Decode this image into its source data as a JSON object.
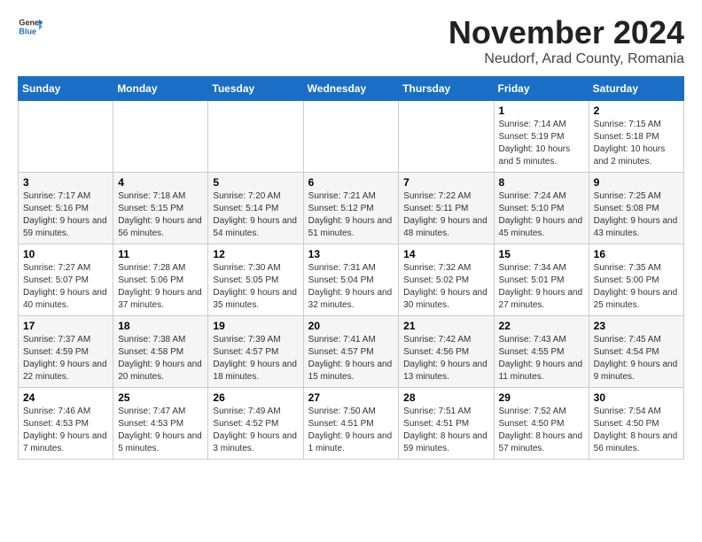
{
  "header": {
    "logo": {
      "general": "General",
      "blue": "Blue"
    },
    "title": "November 2024",
    "location": "Neudorf, Arad County, Romania"
  },
  "calendar": {
    "headers": [
      "Sunday",
      "Monday",
      "Tuesday",
      "Wednesday",
      "Thursday",
      "Friday",
      "Saturday"
    ],
    "weeks": [
      [
        {
          "day": "",
          "info": ""
        },
        {
          "day": "",
          "info": ""
        },
        {
          "day": "",
          "info": ""
        },
        {
          "day": "",
          "info": ""
        },
        {
          "day": "",
          "info": ""
        },
        {
          "day": "1",
          "info": "Sunrise: 7:14 AM\nSunset: 5:19 PM\nDaylight: 10 hours and 5 minutes."
        },
        {
          "day": "2",
          "info": "Sunrise: 7:15 AM\nSunset: 5:18 PM\nDaylight: 10 hours and 2 minutes."
        }
      ],
      [
        {
          "day": "3",
          "info": "Sunrise: 7:17 AM\nSunset: 5:16 PM\nDaylight: 9 hours and 59 minutes."
        },
        {
          "day": "4",
          "info": "Sunrise: 7:18 AM\nSunset: 5:15 PM\nDaylight: 9 hours and 56 minutes."
        },
        {
          "day": "5",
          "info": "Sunrise: 7:20 AM\nSunset: 5:14 PM\nDaylight: 9 hours and 54 minutes."
        },
        {
          "day": "6",
          "info": "Sunrise: 7:21 AM\nSunset: 5:12 PM\nDaylight: 9 hours and 51 minutes."
        },
        {
          "day": "7",
          "info": "Sunrise: 7:22 AM\nSunset: 5:11 PM\nDaylight: 9 hours and 48 minutes."
        },
        {
          "day": "8",
          "info": "Sunrise: 7:24 AM\nSunset: 5:10 PM\nDaylight: 9 hours and 45 minutes."
        },
        {
          "day": "9",
          "info": "Sunrise: 7:25 AM\nSunset: 5:08 PM\nDaylight: 9 hours and 43 minutes."
        }
      ],
      [
        {
          "day": "10",
          "info": "Sunrise: 7:27 AM\nSunset: 5:07 PM\nDaylight: 9 hours and 40 minutes."
        },
        {
          "day": "11",
          "info": "Sunrise: 7:28 AM\nSunset: 5:06 PM\nDaylight: 9 hours and 37 minutes."
        },
        {
          "day": "12",
          "info": "Sunrise: 7:30 AM\nSunset: 5:05 PM\nDaylight: 9 hours and 35 minutes."
        },
        {
          "day": "13",
          "info": "Sunrise: 7:31 AM\nSunset: 5:04 PM\nDaylight: 9 hours and 32 minutes."
        },
        {
          "day": "14",
          "info": "Sunrise: 7:32 AM\nSunset: 5:02 PM\nDaylight: 9 hours and 30 minutes."
        },
        {
          "day": "15",
          "info": "Sunrise: 7:34 AM\nSunset: 5:01 PM\nDaylight: 9 hours and 27 minutes."
        },
        {
          "day": "16",
          "info": "Sunrise: 7:35 AM\nSunset: 5:00 PM\nDaylight: 9 hours and 25 minutes."
        }
      ],
      [
        {
          "day": "17",
          "info": "Sunrise: 7:37 AM\nSunset: 4:59 PM\nDaylight: 9 hours and 22 minutes."
        },
        {
          "day": "18",
          "info": "Sunrise: 7:38 AM\nSunset: 4:58 PM\nDaylight: 9 hours and 20 minutes."
        },
        {
          "day": "19",
          "info": "Sunrise: 7:39 AM\nSunset: 4:57 PM\nDaylight: 9 hours and 18 minutes."
        },
        {
          "day": "20",
          "info": "Sunrise: 7:41 AM\nSunset: 4:57 PM\nDaylight: 9 hours and 15 minutes."
        },
        {
          "day": "21",
          "info": "Sunrise: 7:42 AM\nSunset: 4:56 PM\nDaylight: 9 hours and 13 minutes."
        },
        {
          "day": "22",
          "info": "Sunrise: 7:43 AM\nSunset: 4:55 PM\nDaylight: 9 hours and 11 minutes."
        },
        {
          "day": "23",
          "info": "Sunrise: 7:45 AM\nSunset: 4:54 PM\nDaylight: 9 hours and 9 minutes."
        }
      ],
      [
        {
          "day": "24",
          "info": "Sunrise: 7:46 AM\nSunset: 4:53 PM\nDaylight: 9 hours and 7 minutes."
        },
        {
          "day": "25",
          "info": "Sunrise: 7:47 AM\nSunset: 4:53 PM\nDaylight: 9 hours and 5 minutes."
        },
        {
          "day": "26",
          "info": "Sunrise: 7:49 AM\nSunset: 4:52 PM\nDaylight: 9 hours and 3 minutes."
        },
        {
          "day": "27",
          "info": "Sunrise: 7:50 AM\nSunset: 4:51 PM\nDaylight: 9 hours and 1 minute."
        },
        {
          "day": "28",
          "info": "Sunrise: 7:51 AM\nSunset: 4:51 PM\nDaylight: 8 hours and 59 minutes."
        },
        {
          "day": "29",
          "info": "Sunrise: 7:52 AM\nSunset: 4:50 PM\nDaylight: 8 hours and 57 minutes."
        },
        {
          "day": "30",
          "info": "Sunrise: 7:54 AM\nSunset: 4:50 PM\nDaylight: 8 hours and 56 minutes."
        }
      ]
    ]
  }
}
